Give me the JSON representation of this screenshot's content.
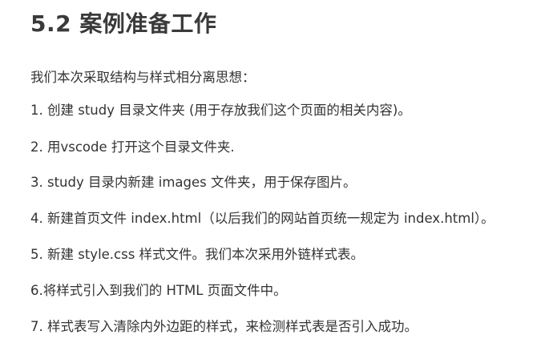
{
  "heading": "5.2 案例准备工作",
  "intro": "我们本次采取结构与样式相分离思想：",
  "steps": [
    "1. 创建 study 目录文件夹 (用于存放我们这个页面的相关内容)。",
    "2. 用vscode 打开这个目录文件夹.",
    "3. study 目录内新建 images 文件夹，用于保存图片。",
    "4. 新建首页文件 index.html（以后我们的网站首页统一规定为 index.html）。",
    "5. 新建 style.css 样式文件。我们本次采用外链样式表。",
    "6.将样式引入到我们的 HTML 页面文件中。",
    "7. 样式表写入清除内外边距的样式，来检测样式表是否引入成功。"
  ]
}
